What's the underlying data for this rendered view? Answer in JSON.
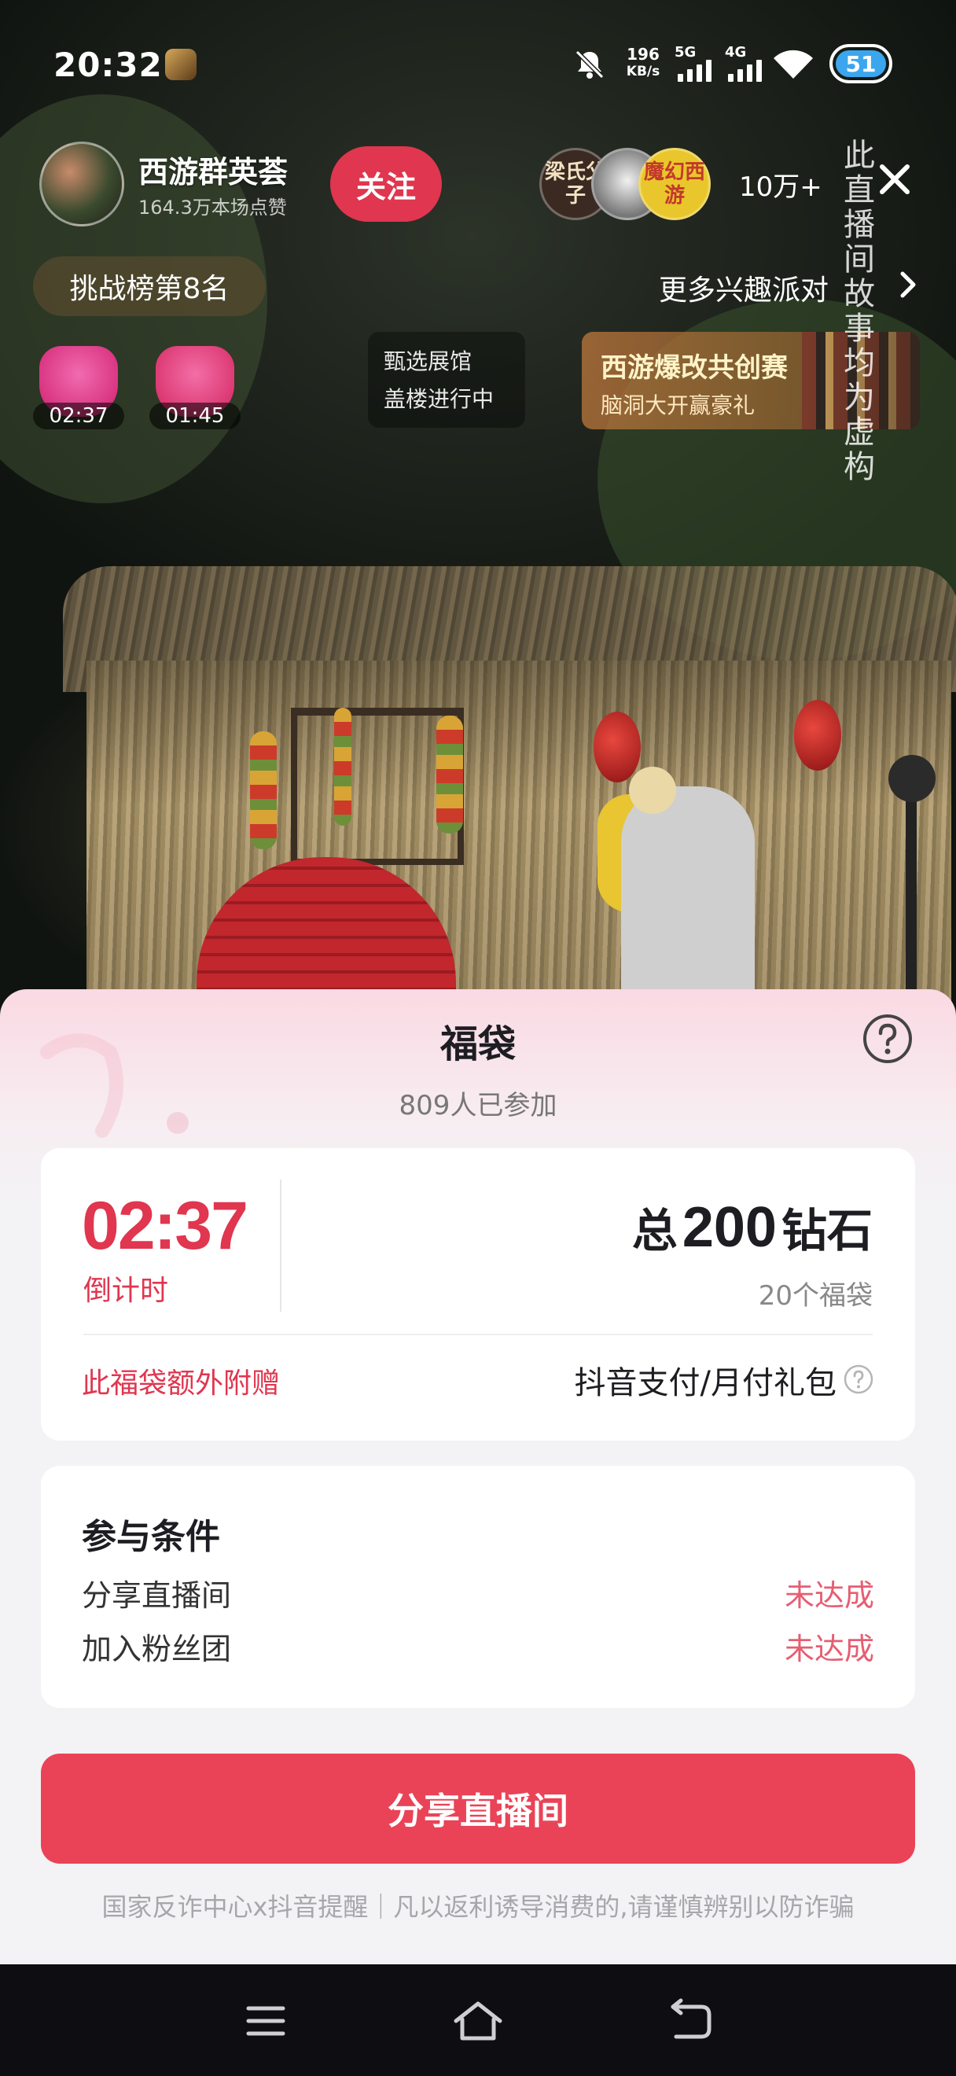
{
  "status_bar": {
    "time": "20:32",
    "net_speed_value": "196",
    "net_speed_unit": "KB/s",
    "sim1_type": "5G",
    "sim2_type": "4G",
    "battery": "51",
    "battery_color": "#3ba6ee",
    "icons": [
      "app-notification-icon",
      "mute-icon",
      "signal-icon",
      "wifi-icon",
      "battery-icon"
    ]
  },
  "live": {
    "anchor_name": "西游群英荟",
    "anchor_sub": "164.3万本场点赞",
    "follow_label": "关注",
    "viewer_badges": [
      "梁氏父子",
      "",
      "魔幻西游"
    ],
    "viewer_count": "10万+",
    "rank_label": "挑战榜第8名",
    "more_label": "更多兴趣派对",
    "bag_timers": [
      "02:37",
      "01:45"
    ],
    "store_tip": [
      "甄选展馆",
      "盖楼进行中"
    ],
    "event_title": "西游爆改共创赛",
    "event_sub": "脑洞大开赢豪礼",
    "disclaimer": "此直播间故事均为虚构"
  },
  "sheet": {
    "title": "福袋",
    "joined": "809人已参加",
    "countdown": "02:37",
    "countdown_label": "倒计时",
    "total_prefix": "总",
    "total_amount": "200",
    "total_unit": "钻石",
    "bag_count": "20个福袋",
    "extra_label": "此福袋额外附赠",
    "extra_value": "抖音支付/月付礼包",
    "conditions_title": "参与条件",
    "conditions": [
      {
        "name": "分享直播间",
        "state": "未达成"
      },
      {
        "name": "加入粉丝团",
        "state": "未达成"
      }
    ],
    "action_label": "分享直播间",
    "fraud_tip": "国家反诈中心x抖音提醒｜凡以返利诱导消费的,请谨慎辨别以防诈骗",
    "accent_color": "#e0364f"
  },
  "navbar": {
    "icons": [
      "menu-icon",
      "home-icon",
      "back-icon"
    ]
  }
}
